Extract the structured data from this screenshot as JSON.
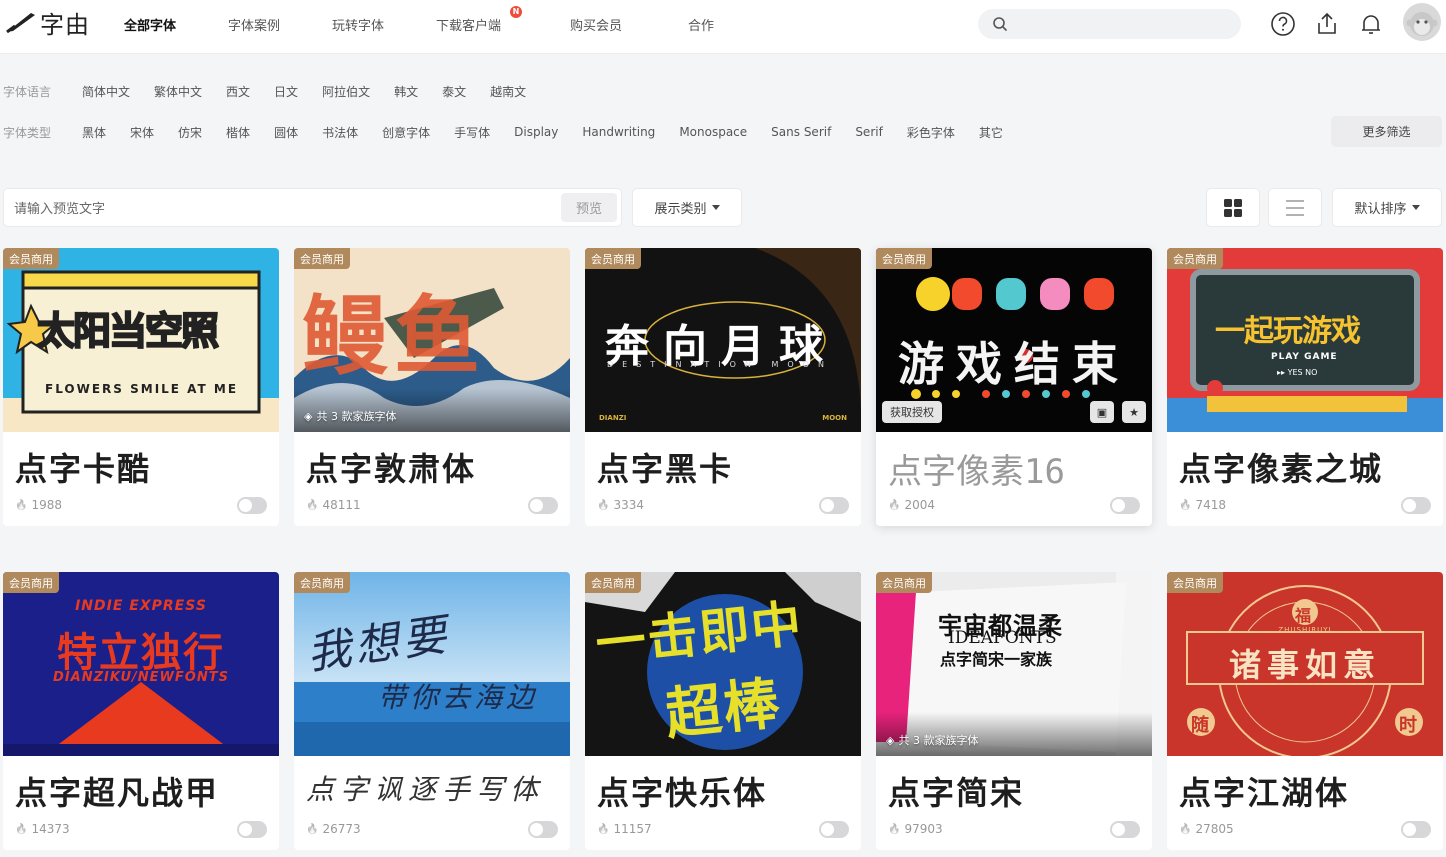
{
  "header": {
    "logo_text": "字由",
    "nav": [
      {
        "label": "全部字体",
        "active": true
      },
      {
        "label": "字体案例"
      },
      {
        "label": "玩转字体"
      },
      {
        "label": "下载客户端",
        "dot": "N"
      },
      {
        "label": "购买会员"
      },
      {
        "label": "合作"
      }
    ],
    "search_placeholder": ""
  },
  "filters": {
    "language_label": "字体语言",
    "languages": [
      "简体中文",
      "繁体中文",
      "西文",
      "日文",
      "阿拉伯文",
      "韩文",
      "泰文",
      "越南文"
    ],
    "type_label": "字体类型",
    "types": [
      "黑体",
      "宋体",
      "仿宋",
      "楷体",
      "圆体",
      "书法体",
      "创意字体",
      "手写体",
      "Display",
      "Handwriting",
      "Monospace",
      "Sans Serif",
      "Serif",
      "彩色字体",
      "其它"
    ],
    "more_label": "更多筛选"
  },
  "toolbar": {
    "preview_placeholder": "请输入预览文字",
    "preview_button": "预览",
    "category_button": "展示类别",
    "sort_button": "默认排序"
  },
  "cards": [
    {
      "badge": "会员商用",
      "name": "点字卡酷",
      "count": "1988",
      "art_text": "太阳当空照",
      "art_sub": "FLOWERS SMILE AT ME"
    },
    {
      "badge": "会员商用",
      "name": "点字敦肃体",
      "count": "48111",
      "family": "共 3 款家族字体",
      "art_text": "鳗鱼"
    },
    {
      "badge": "会员商用",
      "name": "点字黑卡",
      "count": "3334",
      "art_text": "奔向月球",
      "art_sub": "DESTINATION MOON",
      "art_corner_left": "DIANZI",
      "art_corner_right": "MOON"
    },
    {
      "badge": "会员商用",
      "name": "点字像素16",
      "count": "2004",
      "overlay_label": "获取授权",
      "art_text": "游戏结束"
    },
    {
      "badge": "会员商用",
      "name": "点字像素之城",
      "count": "7418",
      "art_text": "一起玩游戏",
      "art_sub": "PLAY GAME",
      "art_sub2": "▸▸ YES   NO"
    },
    {
      "badge": "会员商用",
      "name": "点字超凡战甲",
      "count": "14373",
      "art_text": "特立独行",
      "art_sub": "INDIE EXPRESS",
      "art_sub2": "DIANZIKU/NEWFONTS"
    },
    {
      "badge": "会员商用",
      "name": "点字讽逐手写体",
      "count": "26773",
      "art_text": "我想要",
      "art_sub": "带你去海边"
    },
    {
      "badge": "会员商用",
      "name": "点字快乐体",
      "count": "11157",
      "art_text": "一击即中",
      "art_sub": "超棒"
    },
    {
      "badge": "会员商用",
      "name": "点字简宋",
      "count": "97903",
      "family": "共 3 款家族字体",
      "art_text": "宇宙都温柔",
      "art_sub": "IDEAFONTS",
      "art_sub2": "点字简宋一家族"
    },
    {
      "badge": "会员商用",
      "name": "点字江湖体",
      "count": "27805",
      "art_text": "诸事如意",
      "art_sub": "福",
      "art_sub2": "ZHUSHIRUYI",
      "art_corner_left": "随",
      "art_corner_right": "时"
    }
  ],
  "colors": {
    "badge": "#b08a5d",
    "dot": "#f04a3a"
  }
}
